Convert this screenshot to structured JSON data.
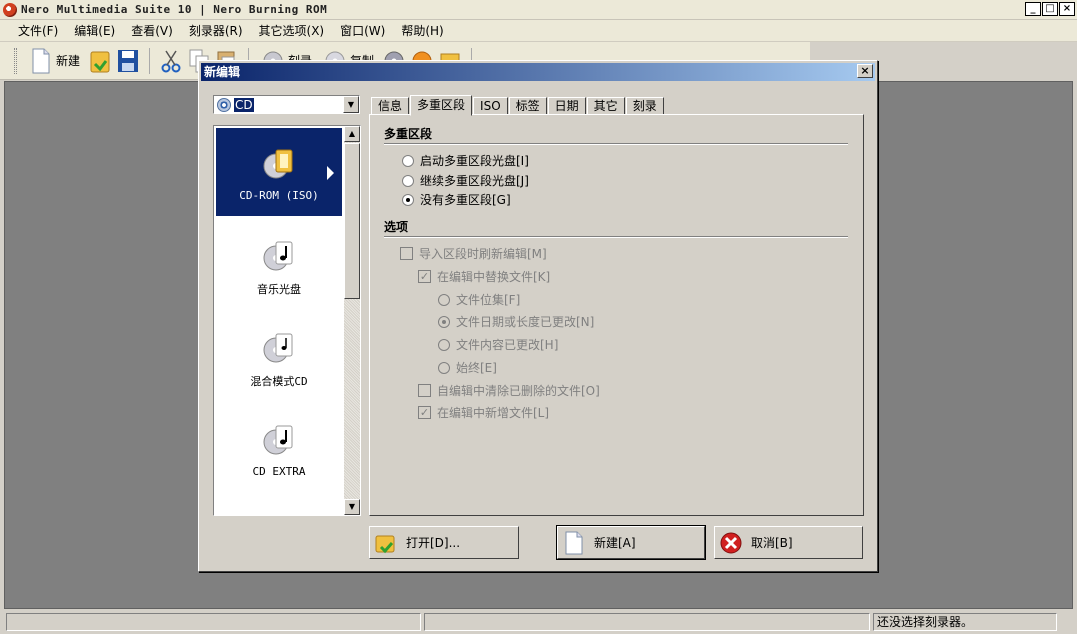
{
  "window": {
    "title": "Nero Multimedia Suite 10 | Nero Burning ROM",
    "buttons": [
      "_",
      "□",
      "×"
    ]
  },
  "menu": [
    "文件(F)",
    "编辑(E)",
    "查看(V)",
    "刻录器(R)",
    "其它选项(X)",
    "窗口(W)",
    "帮助(H)"
  ],
  "toolbar": {
    "new_label": "新建",
    "burn_label": "刻录",
    "copy_label": "复制"
  },
  "status": {
    "recorder": "还没选择刻录器。"
  },
  "dialog": {
    "title": "新编辑",
    "close": "×",
    "disc_type": "CD",
    "compilation_types": [
      "CD-ROM (ISO)",
      "音乐光盘",
      "混合模式CD",
      "CD EXTRA"
    ],
    "selected_type": 0,
    "tabs": [
      "信息",
      "多重区段",
      "ISO",
      "标签",
      "日期",
      "其它",
      "刻录"
    ],
    "active_tab": 1,
    "multisession": {
      "heading": "多重区段",
      "options": [
        "启动多重区段光盘[I]",
        "继续多重区段光盘[J]",
        "没有多重区段[G]"
      ],
      "selected": 2
    },
    "options_section": {
      "heading": "选项",
      "refresh_on_import": "导入区段时刷新编辑[M]",
      "replace_files": "在编辑中替换文件[K]",
      "replace_modes": [
        "文件位集[F]",
        "文件日期或长度已更改[N]",
        "文件内容已更改[H]",
        "始终[E]"
      ],
      "replace_selected": 1,
      "remove_deleted": "自编辑中清除已删除的文件[O]",
      "add_new": "在编辑中新增文件[L]"
    },
    "buttons": {
      "open": "打开[D]...",
      "new": "新建[A]",
      "cancel": "取消[B]"
    }
  }
}
